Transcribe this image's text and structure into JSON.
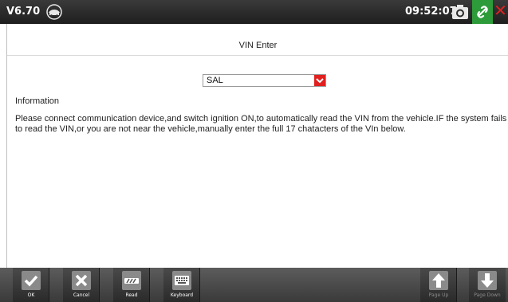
{
  "status_bar": {
    "version": "V6.70",
    "time": "09:52:07",
    "icons": [
      "vin-logo-icon",
      "camera-icon",
      "link-icon",
      "close-icon"
    ]
  },
  "main": {
    "title": "VIN Enter",
    "vin_select": {
      "value": "SAL"
    },
    "info_label": "Information",
    "info_text": "Please connect communication device,and switch ignition ON,to automatically read the VIN from the vehicle.IF the system fails to read the VIN,or you are not near the vehicle,manually enter the full 17 chatacters of the VIn below."
  },
  "toolbar": {
    "ok_label": "OK",
    "cancel_label": "Cancel",
    "read_label": "Read",
    "keyboard_label": "Keyboard",
    "page_up_label": "Page Up",
    "page_down_label": "Page Down"
  },
  "colors": {
    "accent_red": "#e0201f",
    "link_green": "#2e9b3a",
    "bar_dark": "#2a2a2a"
  }
}
